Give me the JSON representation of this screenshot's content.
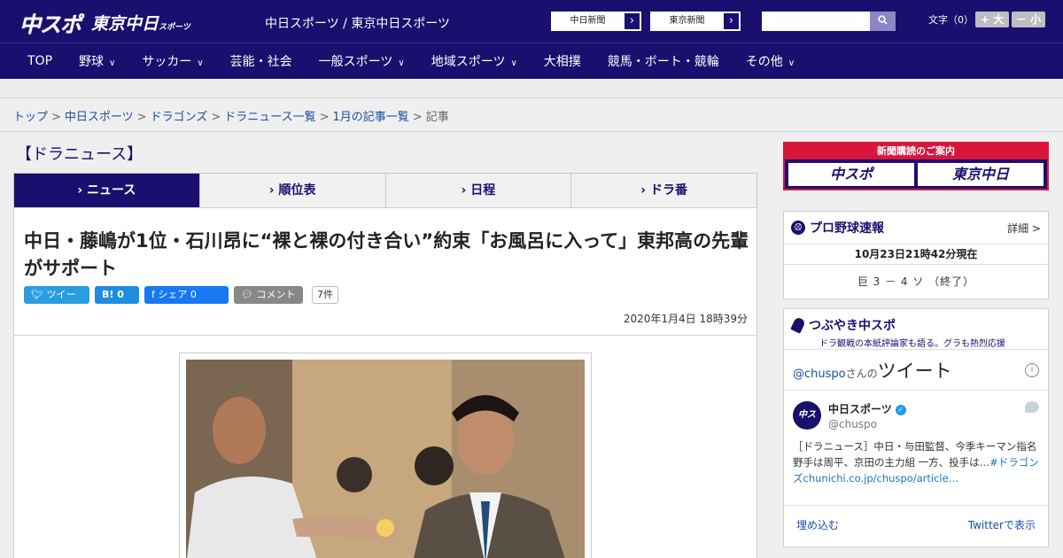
{
  "header": {
    "logo_main": "中スポ",
    "logo_tokyo": "東京中日",
    "logo_tokyo_small": "スポーツ",
    "site_label": "中日スポーツ / 東京中日スポーツ",
    "ext_links": [
      {
        "label": "中日新聞",
        "arrow": "›"
      },
      {
        "label": "東京新聞",
        "arrow": "›"
      }
    ],
    "search_placeholder": "",
    "search_icon": "search-icon",
    "fontsize_label": "文字（0）",
    "fontsize_up": "+ 大",
    "fontsize_down": "－ 小"
  },
  "nav": [
    {
      "label": "TOP",
      "chevron": ""
    },
    {
      "label": "野球",
      "chevron": "∨"
    },
    {
      "label": "サッカー",
      "chevron": "∨"
    },
    {
      "label": "芸能・社会",
      "chevron": ""
    },
    {
      "label": "一般スポーツ",
      "chevron": "∨"
    },
    {
      "label": "地域スポーツ",
      "chevron": "∨"
    },
    {
      "label": "大相撲",
      "chevron": ""
    },
    {
      "label": "競馬・ボート・競輪",
      "chevron": ""
    },
    {
      "label": "その他",
      "chevron": "∨"
    }
  ],
  "breadcrumb": {
    "items": [
      "トップ",
      "中日スポーツ",
      "ドラゴンズ",
      "ドラニュース一覧",
      "1月の記事一覧"
    ],
    "current": "記事",
    "sep": ">"
  },
  "section_title": "【ドラニュース】",
  "tabs": [
    {
      "label": "› ニュース",
      "active": true
    },
    {
      "label": "› 順位表",
      "active": false
    },
    {
      "label": "› 日程",
      "active": false
    },
    {
      "label": "› ドラ番",
      "active": false
    }
  ],
  "article": {
    "headline": "中日・藤嶋が1位・石川昂に“裸と裸の付き合い”約束「お風呂に入って」東邦高の先輩がサポート",
    "social": {
      "tweet": "ツイート",
      "hatena": "B! 0",
      "facebook": "f  シェア 0",
      "comment": "コメント",
      "comment_count": "7件"
    },
    "date": "2020年1月4日 18時39分"
  },
  "sidebar": {
    "ad": {
      "top": "新聞購読のご案内",
      "logo_a": "中スポ",
      "logo_b": "東京中日"
    },
    "baseball": {
      "title": "プロ野球速報",
      "detail": "詳細 >",
      "time": "10月23日21時42分現在",
      "score": "巨 3 － 4 ソ （終了）"
    },
    "tsubuyaki": {
      "title": "つぶやき中スポ",
      "subtitle": "ドラ観戦の本紙評論家も語る。グラも熱烈応援",
      "handle_prefix": "@chuspo",
      "handle_mid": "さんの",
      "handle_suffix": "ツイート",
      "tweet_name": "中日スポーツ",
      "tweet_handle": "@chuspo",
      "tweet_text": "［ドラニュース］中日・与田監督、今季キーマン指名 野手は周平、京田の主力組 一方、投手は…",
      "tweet_link": "#ドラゴンズchunichi.co.jp/chuspo/article…",
      "embed": "埋め込む",
      "view_on_twitter": "Twitterで表示"
    }
  }
}
